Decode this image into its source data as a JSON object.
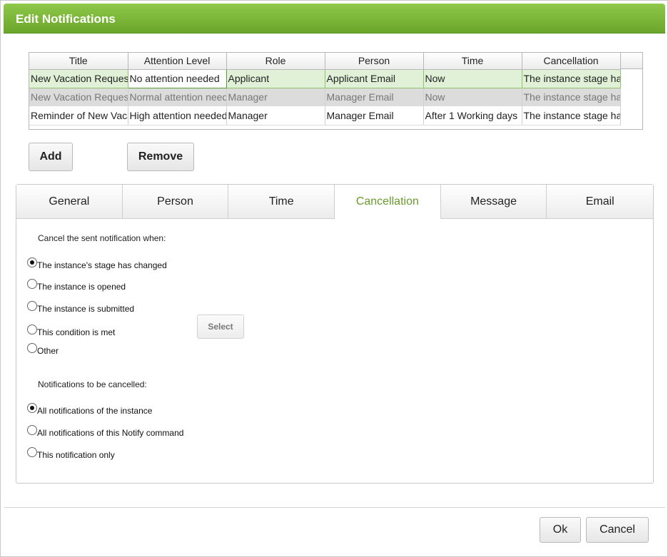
{
  "dialog": {
    "title": "Edit Notifications"
  },
  "grid": {
    "columns": [
      "Title",
      "Attention Level",
      "Role",
      "Person",
      "Time",
      "Cancellation"
    ],
    "rows": [
      [
        "New Vacation Request",
        "No attention needed",
        "Applicant",
        "Applicant Email",
        "Now",
        "The instance stage has changed"
      ],
      [
        "New Vacation Request",
        "Normal attention needed",
        "Manager",
        "Manager Email",
        "Now",
        "The instance stage has changed"
      ],
      [
        "Reminder of New Vacation Request",
        "High attention needed",
        "Manager",
        "Manager Email",
        "After 1 Working days",
        "The instance stage has changed"
      ]
    ]
  },
  "buttons": {
    "add": "Add",
    "remove": "Remove",
    "select": "Select",
    "ok": "Ok",
    "cancel": "Cancel"
  },
  "tabs": [
    "General",
    "Person",
    "Time",
    "Cancellation",
    "Message",
    "Email"
  ],
  "active_tab": "Cancellation",
  "cancellation": {
    "cancel_when_label": "Cancel the sent notification when:",
    "cancel_when_options": [
      {
        "label": "The instance's stage has changed",
        "checked": true
      },
      {
        "label": "The instance is opened",
        "checked": false
      },
      {
        "label": "The instance is submitted",
        "checked": false
      },
      {
        "label": "This condition is met",
        "checked": false
      },
      {
        "label": "Other",
        "checked": false
      }
    ],
    "scope_label": "Notifications to be cancelled:",
    "scope_options": [
      {
        "label": "All notifications of the instance",
        "checked": true
      },
      {
        "label": "All notifications of this Notify command",
        "checked": false
      },
      {
        "label": "This notification only",
        "checked": false
      }
    ]
  },
  "colors": {
    "title_bar": "#7ab93a",
    "active_tab_text": "#6a9a2e",
    "selected_row": "#e0f1d7"
  }
}
